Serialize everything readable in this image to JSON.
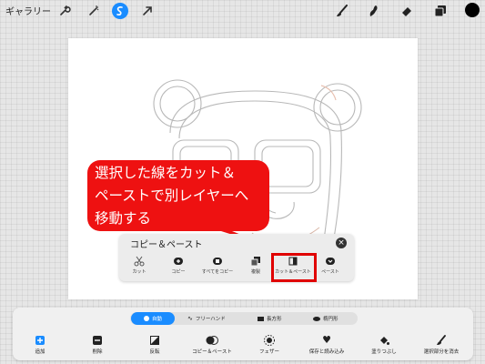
{
  "topbar": {
    "gallery_label": "ギャラリー",
    "icons": [
      "wrench-icon",
      "magic-wand-icon",
      "selection-icon",
      "transform-arrow-icon",
      "brush-icon",
      "smudge-icon",
      "eraser-icon",
      "layers-icon"
    ],
    "color_swatch": "#000000"
  },
  "annotation": {
    "lines": [
      "選択した線をカット＆",
      "ペーストで別レイヤーへ",
      "移動する"
    ],
    "color": "#ee1111"
  },
  "copy_paste_panel": {
    "title": "コピー＆ペースト",
    "items": [
      {
        "label": "カット",
        "icon": "scissors-icon"
      },
      {
        "label": "コピー",
        "icon": "copy-icon"
      },
      {
        "label": "すべてをコピー",
        "icon": "copy-all-icon"
      },
      {
        "label": "複製",
        "icon": "duplicate-icon"
      },
      {
        "label": "カット＆ペースト",
        "icon": "cut-paste-icon"
      },
      {
        "label": "ペースト",
        "icon": "paste-icon"
      }
    ],
    "highlighted_item": "カット＆ペースト"
  },
  "selection_modes": [
    {
      "label": "自動",
      "active": true
    },
    {
      "label": "フリーハンド",
      "active": false
    },
    {
      "label": "長方形",
      "active": false
    },
    {
      "label": "楕円形",
      "active": false
    }
  ],
  "actions": [
    {
      "label": "追加",
      "icon": "plus-icon"
    },
    {
      "label": "削除",
      "icon": "minus-icon"
    },
    {
      "label": "反転",
      "icon": "invert-icon"
    },
    {
      "label": "コピー＆ペースト",
      "icon": "copy-paste-icon"
    },
    {
      "label": "フェザー",
      "icon": "feather-icon"
    },
    {
      "label": "保存と読み込み",
      "icon": "heart-icon"
    },
    {
      "label": "塗りつぶし",
      "icon": "fill-icon"
    },
    {
      "label": "選択部分を消去",
      "icon": "clear-brush-icon"
    }
  ],
  "accent_color": "#1a8cff"
}
